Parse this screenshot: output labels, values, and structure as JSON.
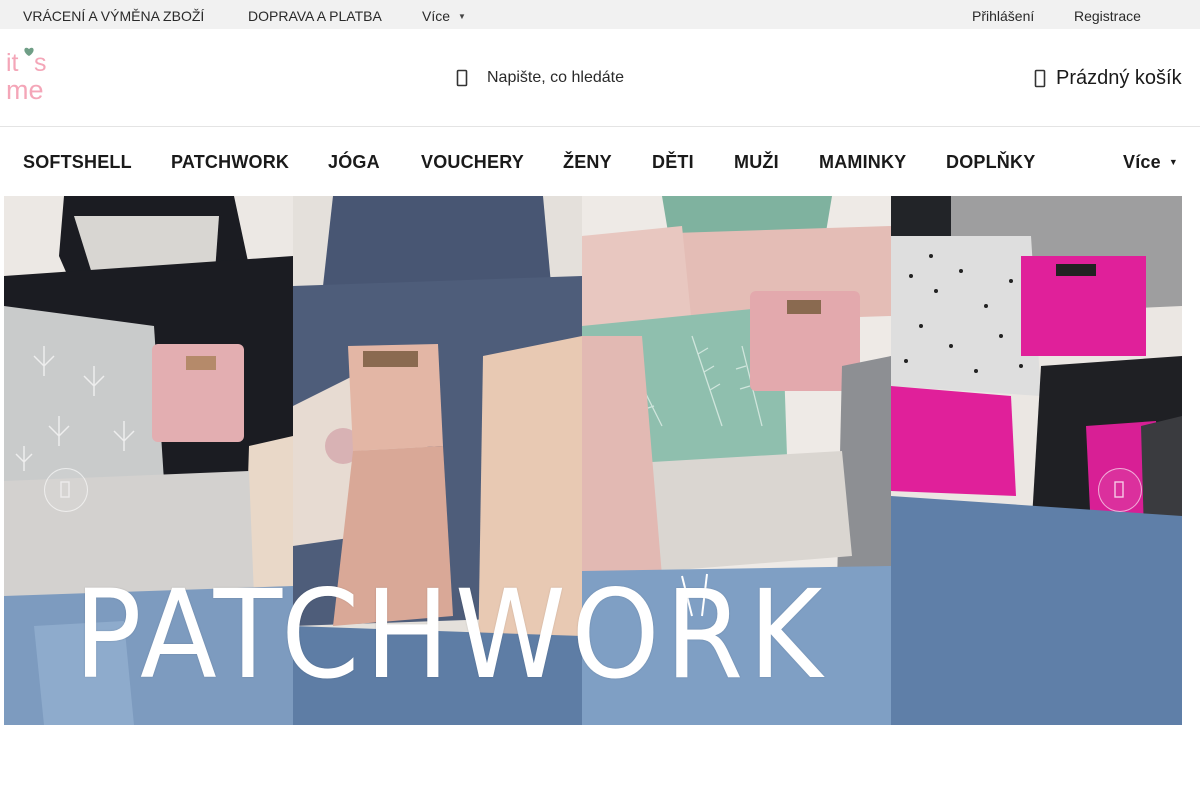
{
  "topbar": {
    "links": [
      "VRÁCENÍ A VÝMĚNA ZBOŽÍ",
      "DOPRAVA A PLATBA",
      "Více"
    ],
    "login": "Přihlášení",
    "register": "Registrace"
  },
  "header": {
    "logo_text": "it's me",
    "search_placeholder": "Napište, co hledáte",
    "cart_label": "Prázdný košík"
  },
  "nav": {
    "items": [
      "SOFTSHELL",
      "PATCHWORK",
      "JÓGA",
      "VOUCHERY",
      "ŽENY",
      "DĚTI",
      "MUŽI",
      "MAMINKY",
      "DOPLŇKY"
    ],
    "more": "Více"
  },
  "hero": {
    "title": "PATCHWORK",
    "colors": {
      "logo_pink": "#f4a6b8",
      "logo_heart": "#6f9e86",
      "hoodie_pink_fleece": "#d9a5a8",
      "hoodie_magenta_fleece": "#e0209a",
      "hoodie_mint": "#8fbfae"
    }
  }
}
